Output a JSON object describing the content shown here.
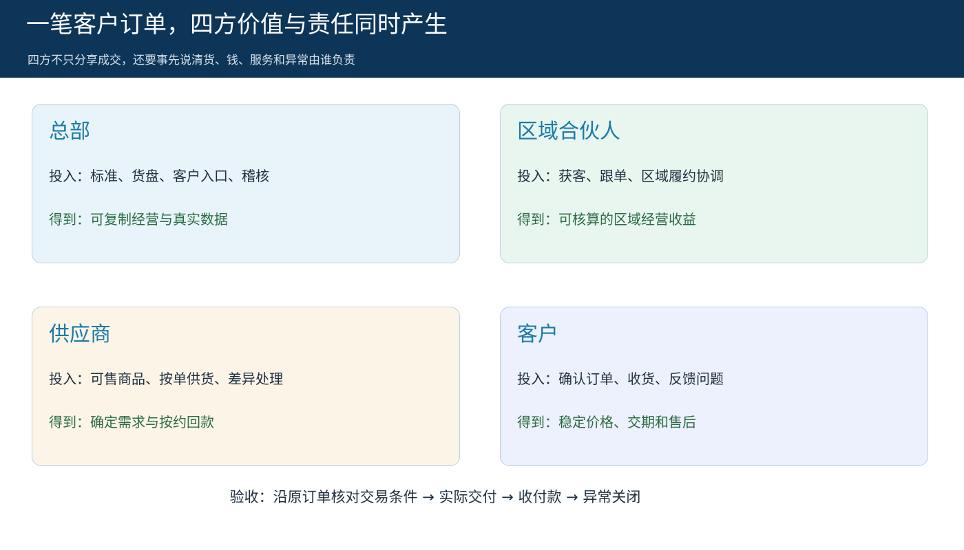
{
  "header": {
    "title": "一笔客户订单，四方价值与责任同时产生",
    "subtitle": "四方不只分享成交，还要事先说清货、钱、服务和异常由谁负责"
  },
  "cards": [
    {
      "title": "总部",
      "input": "投入：标准、货盘、客户入口、稽核",
      "output": "得到：可复制经营与真实数据",
      "bg": "#e9f4fa"
    },
    {
      "title": "区域合伙人",
      "input": "投入：获客、跟单、区域履约协调",
      "output": "得到：可核算的区域经营收益",
      "bg": "#e9f6f0"
    },
    {
      "title": "供应商",
      "input": "投入：可售商品、按单供货、差异处理",
      "output": "得到：确定需求与按约回款",
      "bg": "#fdf4e8"
    },
    {
      "title": "客户",
      "input": "投入：确认订单、收货、反馈问题",
      "output": "得到：稳定价格、交期和售后",
      "bg": "#edf1fd"
    }
  ],
  "footer": {
    "acceptance": "验收：沿原订单核对交易条件 → 实际交付 → 收付款 → 异常关闭"
  },
  "colors": {
    "header_bg": "#0d3558",
    "card_title": "#1a7ba6",
    "input_text": "#1f2f3e",
    "output_text": "#2b6b44",
    "card_border": "#b7d2de"
  }
}
